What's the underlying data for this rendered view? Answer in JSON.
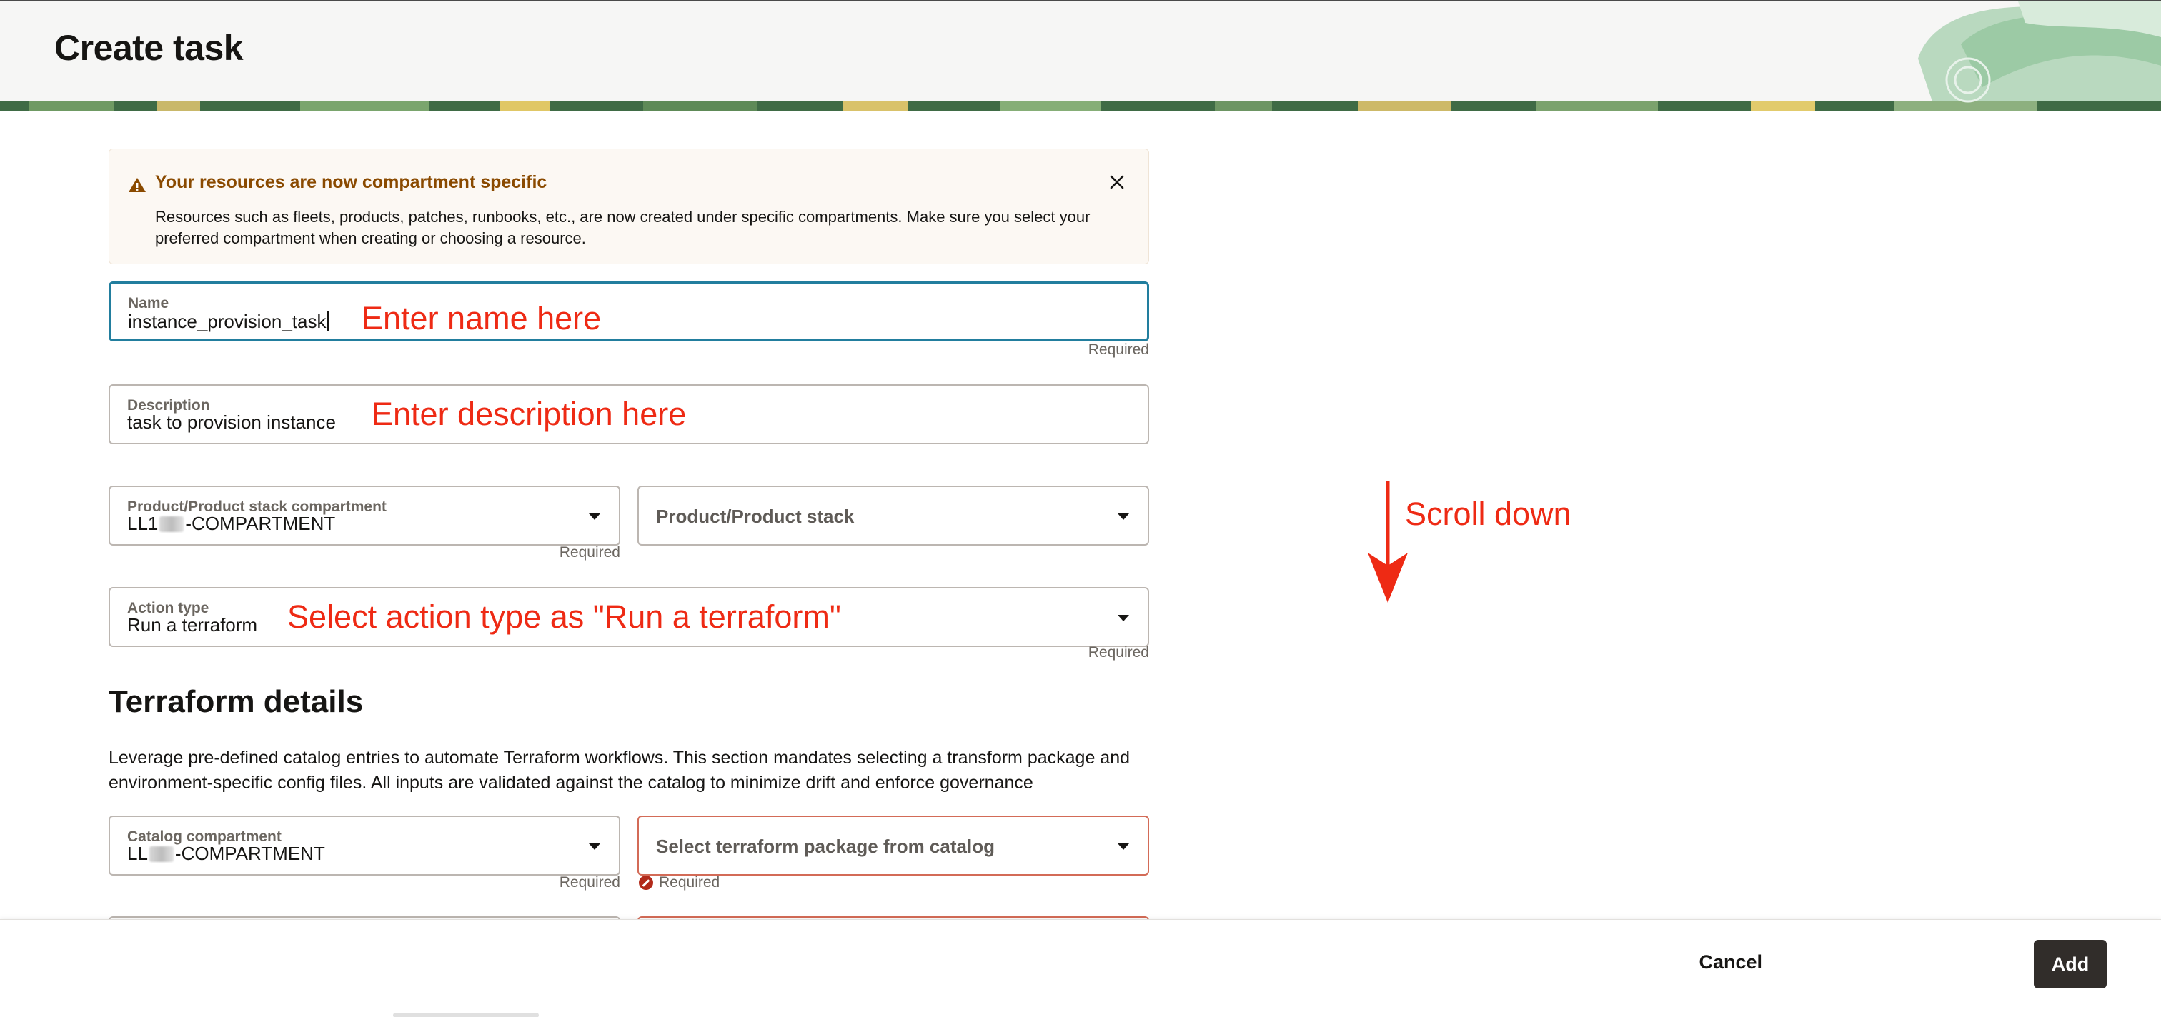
{
  "header": {
    "title": "Create task"
  },
  "alert": {
    "title": "Your resources are now compartment specific",
    "body": "Resources such as fleets, products, patches, runbooks, etc., are now created under specific compartments. Make sure you select your preferred compartment when creating or choosing a resource."
  },
  "fields": {
    "name": {
      "label": "Name",
      "value": "instance_provision_task",
      "helper": "Required"
    },
    "description": {
      "label": "Description",
      "value": "task to provision instance"
    },
    "product_compartment": {
      "label": "Product/Product stack compartment",
      "value_prefix": "LL1",
      "value_suffix": "-COMPARTMENT",
      "helper": "Required"
    },
    "product_stack": {
      "placeholder": "Product/Product stack"
    },
    "action_type": {
      "label": "Action type",
      "value": "Run a terraform",
      "helper": "Required"
    },
    "catalog_compartment": {
      "label": "Catalog compartment",
      "value_prefix": "LL",
      "value_suffix": "-COMPARTMENT",
      "helper": "Required"
    },
    "terraform_package": {
      "placeholder": "Select terraform package from catalog",
      "helper": "Required"
    }
  },
  "terraform_section": {
    "title": "Terraform details",
    "description": "Leverage pre-defined catalog entries to automate Terraform workflows. This section mandates selecting a transform package and environment-specific config files. All inputs are validated against the catalog to minimize drift and enforce governance"
  },
  "annotations": {
    "name": "Enter name here",
    "description": "Enter description here",
    "action_type": "Select action type as \"Run a terraform\"",
    "scroll": "Scroll down"
  },
  "footer": {
    "cancel_label": "Cancel",
    "add_label": "Add"
  },
  "colors": {
    "annotation": "#ee2a14",
    "focus": "#227e9e",
    "error_border": "#d36b57",
    "warning": "#8a4a00",
    "primary_button": "#312d2a"
  },
  "icons": {
    "alert": "warning-icon",
    "close": "close-icon",
    "dropdown": "chevron-down-icon",
    "error": "error-icon"
  }
}
